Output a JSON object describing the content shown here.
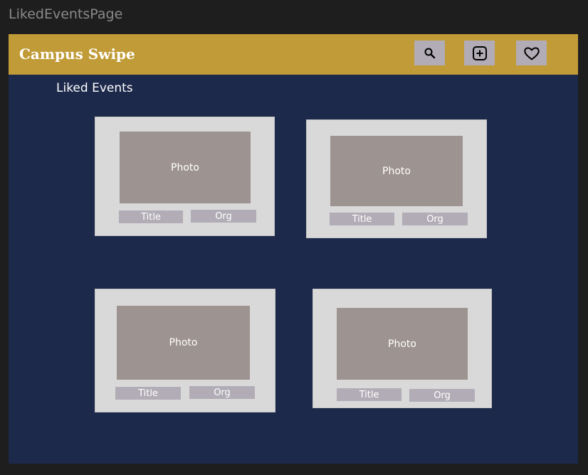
{
  "frame_label": "LikedEventsPage",
  "header": {
    "app_title": "Campus Swipe",
    "icons": [
      "search-icon",
      "plus-square-icon",
      "heart-icon"
    ]
  },
  "section_title": "Liked Events",
  "cards": [
    {
      "photo": "Photo",
      "title": "Title",
      "org": "Org"
    },
    {
      "photo": "Photo",
      "title": "Title",
      "org": "Org"
    },
    {
      "photo": "Photo",
      "title": "Title",
      "org": "Org"
    },
    {
      "photo": "Photo",
      "title": "Title",
      "org": "Org"
    }
  ],
  "colors": {
    "header": "#c09b37",
    "background": "#1c294a",
    "card": "#d9d9d9",
    "photo": "#9d9390",
    "chip": "#b1acb5"
  }
}
